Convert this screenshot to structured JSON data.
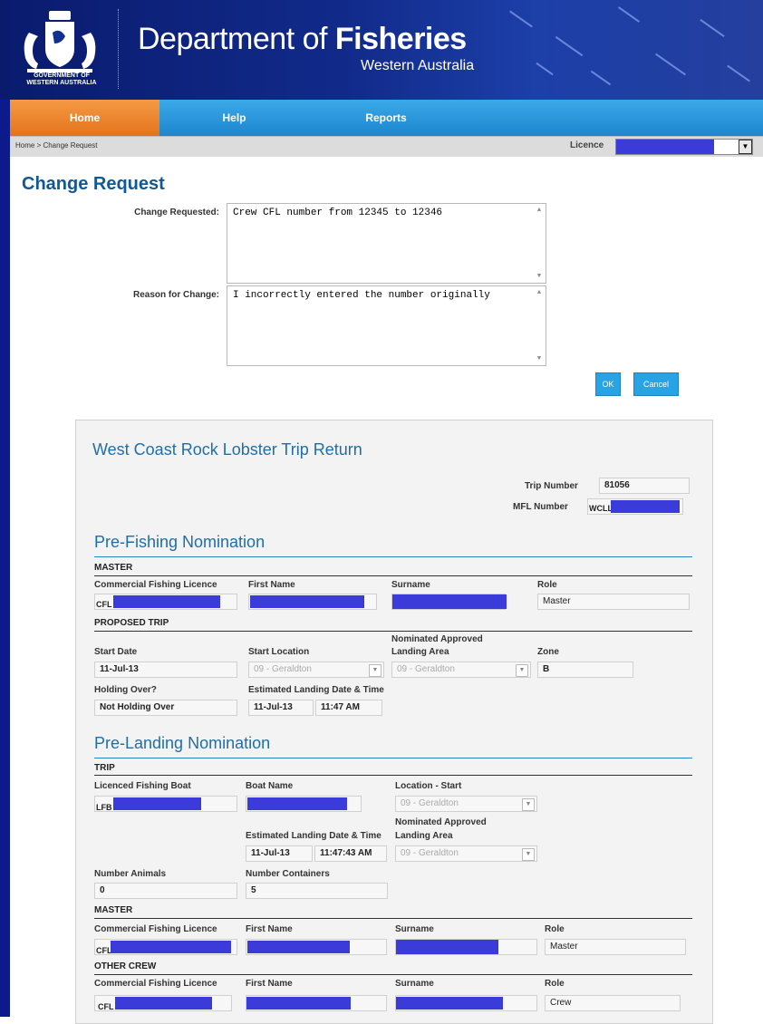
{
  "header": {
    "crest_text_line1": "GOVERNMENT OF",
    "crest_text_line2": "WESTERN AUSTRALIA",
    "title_regular": "Department of ",
    "title_bold": "Fisheries",
    "subtitle": "Western Australia"
  },
  "nav": {
    "items": [
      {
        "label": "Home",
        "active": true
      },
      {
        "label": "Help"
      },
      {
        "label": "Reports"
      }
    ]
  },
  "breadcrumb": {
    "text": "Home > Change Request",
    "licence_label": "Licence"
  },
  "change_request": {
    "title": "Change Request",
    "change_label": "Change Requested:",
    "change_value": "Crew CFL number from 12345 to 12346",
    "reason_label": "Reason for Change:",
    "reason_value": "I incorrectly entered the number originally",
    "ok_label": "OK",
    "cancel_label": "Cancel"
  },
  "trip_return": {
    "title": "West Coast Rock Lobster Trip Return",
    "trip_number_label": "Trip Number",
    "trip_number": "81056",
    "mfl_label": "MFL Number",
    "mfl_prefix": "WCLL",
    "pre_fishing": {
      "title": "Pre-Fishing Nomination",
      "master_header": "MASTER",
      "col_cfl": "Commercial Fishing Licence",
      "col_first": "First Name",
      "col_surname": "Surname",
      "col_role": "Role",
      "cfl_prefix": "CFL",
      "role": "Master",
      "proposed_header": "PROPOSED TRIP",
      "start_date_label": "Start Date",
      "start_date": "11-Jul-13",
      "start_location_label": "Start Location",
      "start_location": "09 - Geraldton",
      "nal_label_1": "Nominated Approved",
      "nal_label_2": "Landing Area",
      "nal": "09 - Geraldton",
      "zone_label": "Zone",
      "zone": "B",
      "holding_label": "Holding Over?",
      "holding": "Not Holding Over",
      "eld_label": "Estimated Landing Date & Time",
      "eld_date": "11-Jul-13",
      "eld_time": "11:47 AM"
    },
    "pre_landing": {
      "title": "Pre-Landing Nomination",
      "trip_header": "TRIP",
      "lfb_label": "Licenced Fishing Boat",
      "lfb_prefix": "LFB",
      "boat_name_label": "Boat Name",
      "loc_start_label": "Location - Start",
      "loc_start": "09 - Geraldton",
      "eld_label": "Estimated Landing Date & Time",
      "eld_date": "11-Jul-13",
      "eld_time": "11:47:43 AM",
      "nal_label_1": "Nominated Approved",
      "nal_label_2": "Landing Area",
      "nal": "09 - Geraldton",
      "animals_label": "Number Animals",
      "animals": "0",
      "containers_label": "Number Containers",
      "containers": "5",
      "master_header": "MASTER",
      "col_cfl": "Commercial Fishing Licence",
      "col_first": "First Name",
      "col_surname": "Surname",
      "col_role": "Role",
      "cfl_prefix": "CFL",
      "master_role": "Master",
      "crew_header": "OTHER CREW",
      "crew_role": "Crew"
    }
  }
}
